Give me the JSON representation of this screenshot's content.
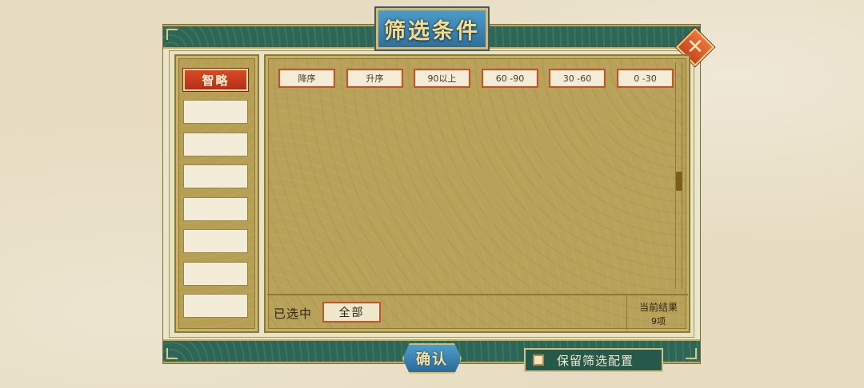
{
  "dialog": {
    "title": "筛选条件",
    "close_icon": "close-icon"
  },
  "categories": {
    "active": "智略",
    "empty_slots": 7
  },
  "filters": [
    {
      "label": "降序"
    },
    {
      "label": "升序"
    },
    {
      "label": "90以上"
    },
    {
      "label": "60 -90"
    },
    {
      "label": "30 -60"
    },
    {
      "label": "0 -30"
    }
  ],
  "footer": {
    "selected_label": "已选中",
    "selected_value": "全部",
    "result_label": "当前结果",
    "result_count": "9项"
  },
  "actions": {
    "confirm": "确认",
    "keep_config": "保留筛选配置"
  },
  "colors": {
    "band": "#2e6656",
    "gold": "#c5a85a",
    "accent_red": "#c9461d",
    "plaque_blue": "#2f6f9d",
    "panel": "#b8a158"
  }
}
